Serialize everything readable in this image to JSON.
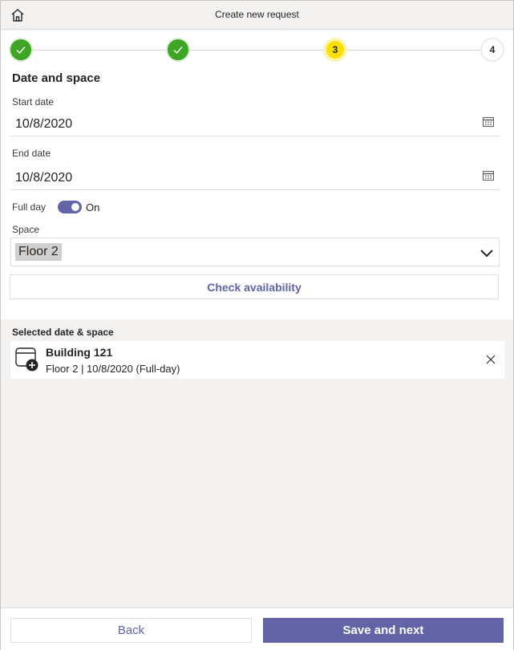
{
  "header": {
    "title": "Create new request",
    "home_icon": "home-icon"
  },
  "stepper": {
    "steps": [
      {
        "label": "",
        "state": "done"
      },
      {
        "label": "",
        "state": "done"
      },
      {
        "label": "3",
        "state": "current"
      },
      {
        "label": "4",
        "state": "pending"
      }
    ]
  },
  "form": {
    "section_title": "Date and space",
    "start_date": {
      "label": "Start date",
      "value": "10/8/2020"
    },
    "end_date": {
      "label": "End date",
      "value": "10/8/2020"
    },
    "full_day": {
      "label": "Full day",
      "state": "On",
      "on": true
    },
    "space": {
      "label": "Space",
      "value": "Floor 2"
    },
    "check_availability_label": "Check availability"
  },
  "selected": {
    "title": "Selected date & space",
    "card": {
      "name": "Building 121",
      "detail": "Floor 2 | 10/8/2020 (Full-day)"
    }
  },
  "footer": {
    "back_label": "Back",
    "next_label": "Save and next"
  },
  "colors": {
    "accent": "#6264a7",
    "success": "#3ea624",
    "current_step": "#fce100"
  }
}
